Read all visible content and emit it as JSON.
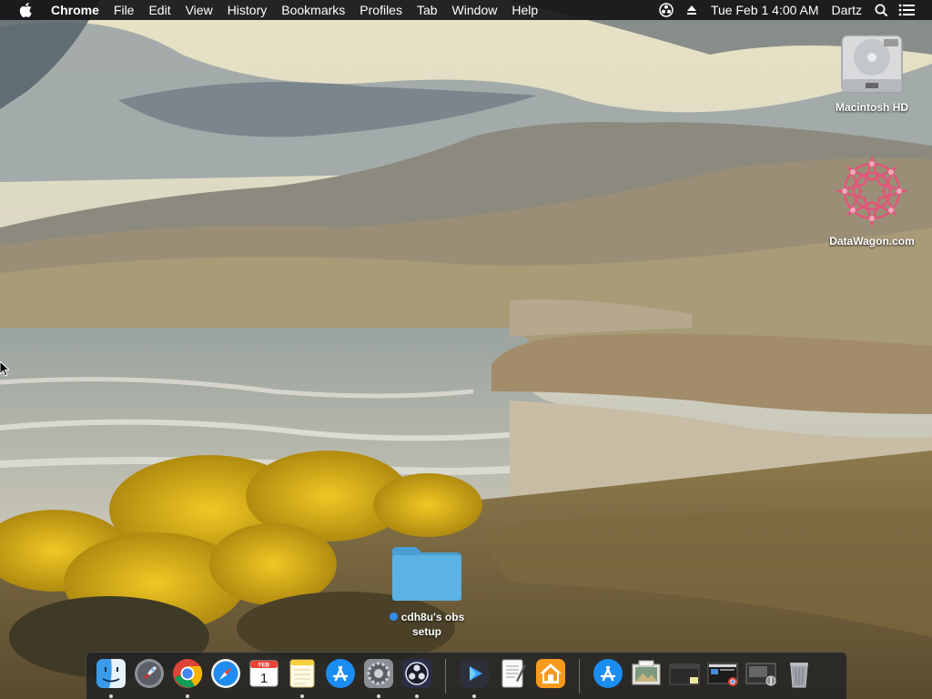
{
  "menubar": {
    "app_name": "Chrome",
    "items": [
      "File",
      "Edit",
      "View",
      "History",
      "Bookmarks",
      "Profiles",
      "Tab",
      "Window",
      "Help"
    ],
    "clock": "Tue Feb 1  4:00 AM",
    "user": "Dartz"
  },
  "desktop": {
    "icons": [
      {
        "label": "Macintosh HD"
      },
      {
        "label": "DataWagon.com"
      }
    ],
    "folder": {
      "label_line1": "cdh8u's obs",
      "label_line2": "setup"
    }
  },
  "dock": {
    "calendar_month": "FEB",
    "calendar_day": "1"
  },
  "colors": {
    "menubar_bg": "#141416",
    "folder_blue": "#5bb2e3",
    "tag_blue": "#2f8ff0"
  }
}
